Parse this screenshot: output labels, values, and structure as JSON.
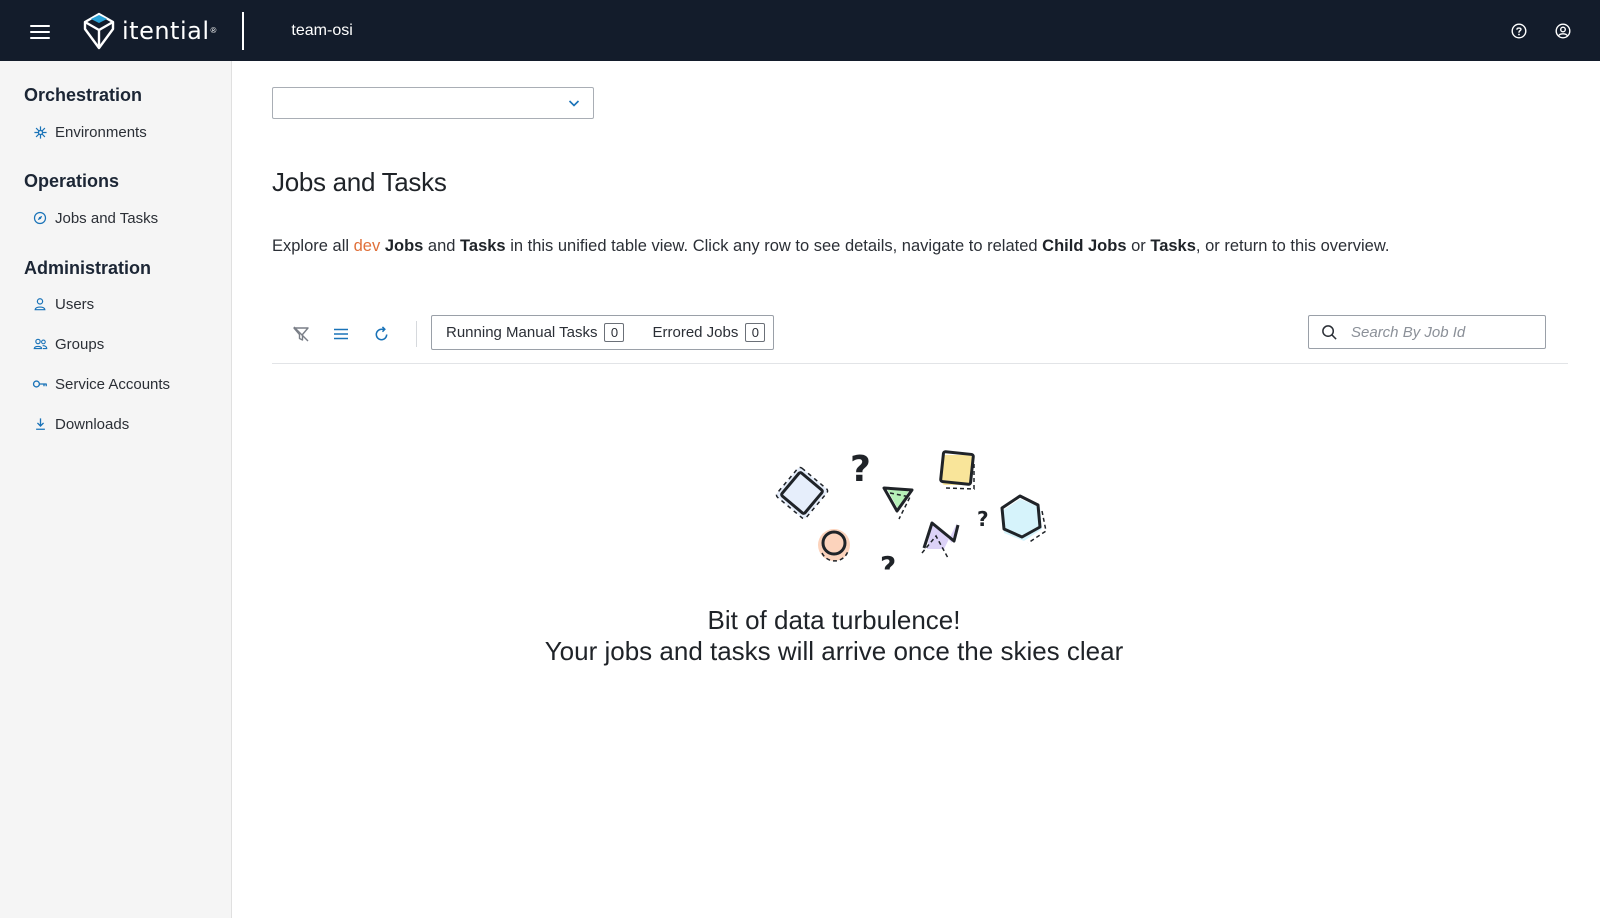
{
  "topbar": {
    "brand": "itential",
    "brand_mark": "®",
    "workspace": "team-osi",
    "icons": [
      "hamburger-menu-icon",
      "itential-logo-icon",
      "help-icon",
      "user-account-icon"
    ]
  },
  "sidebar": {
    "sections": [
      {
        "title": "Orchestration",
        "items": [
          {
            "label": "Environments",
            "icon": "environments-icon"
          }
        ]
      },
      {
        "title": "Operations",
        "items": [
          {
            "label": "Jobs and Tasks",
            "icon": "compass-icon"
          }
        ]
      },
      {
        "title": "Administration",
        "items": [
          {
            "label": "Users",
            "icon": "user-icon"
          },
          {
            "label": "Groups",
            "icon": "groups-icon"
          },
          {
            "label": "Service Accounts",
            "icon": "key-icon"
          },
          {
            "label": "Downloads",
            "icon": "download-icon"
          }
        ]
      }
    ]
  },
  "main": {
    "environment_select": {
      "value": ""
    },
    "title": "Jobs and Tasks",
    "description": {
      "p1": "Explore all ",
      "env": "dev",
      "p2": " ",
      "b1": "Jobs",
      "p3": " and ",
      "b2": "Tasks",
      "p4": " in this unified table view. Click any row to see details, navigate to related ",
      "b3": "Child Jobs",
      "p5": " or ",
      "b4": "Tasks",
      "p6": ", or return to this overview."
    },
    "toolbar": {
      "icons": [
        "filter-icon",
        "list-view-icon",
        "refresh-icon"
      ],
      "tabs": [
        {
          "label": "Running Manual Tasks",
          "count": "0"
        },
        {
          "label": "Errored Jobs",
          "count": "0"
        }
      ],
      "search_placeholder": "Search By Job Id"
    },
    "empty_state": {
      "line1": "Bit of data turbulence!",
      "line2": "Your jobs and tasks will arrive once the skies clear"
    }
  },
  "colors": {
    "topbar_bg": "#131c2b",
    "sidebar_bg": "#f5f5f5",
    "accent_blue": "#1a73b8",
    "env_orange": "#e0703a"
  }
}
